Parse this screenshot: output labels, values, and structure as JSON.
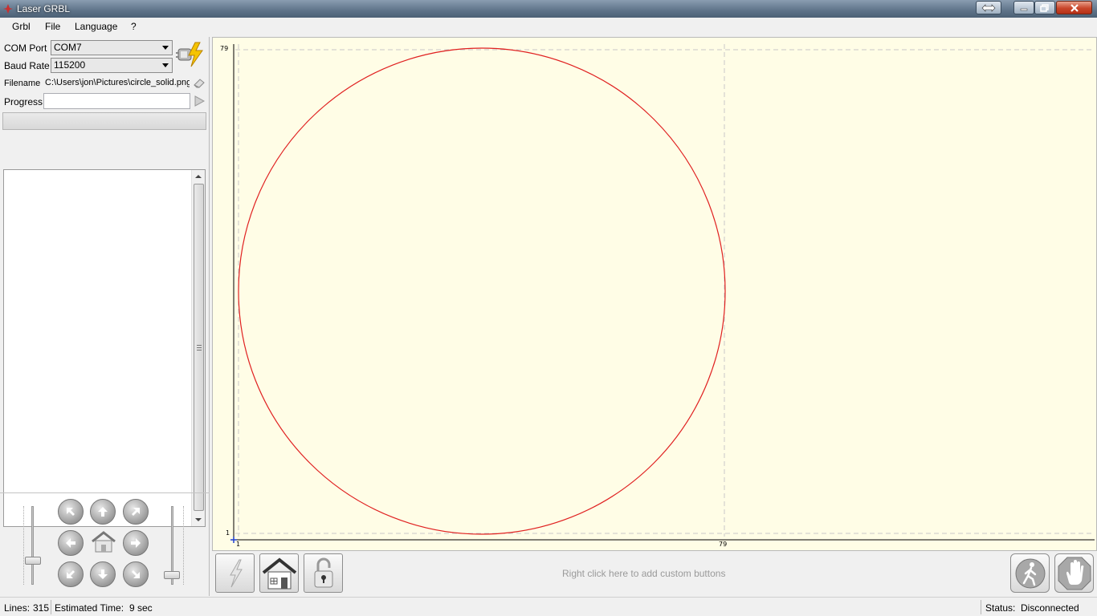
{
  "window": {
    "title": "Laser GRBL"
  },
  "menu": [
    {
      "label": "Grbl"
    },
    {
      "label": "File"
    },
    {
      "label": "Language"
    },
    {
      "label": "?"
    }
  ],
  "connection": {
    "com_port_label": "COM Port",
    "com_port_value": "COM7",
    "baud_rate_label": "Baud Rate",
    "baud_rate_value": "115200"
  },
  "file": {
    "filename_label": "Filename",
    "filename_value": "C:\\Users\\jon\\Pictures\\circle_solid.png",
    "progress_label": "Progress",
    "progress_value": ""
  },
  "canvas": {
    "x_min_label": "1",
    "x_max_label": "79",
    "y_min_label": "1",
    "y_max_label": "79",
    "circle_color": "#e02020",
    "background_color": "#fffde6"
  },
  "custom_buttons_hint": "Right click here to add custom buttons",
  "icons": [
    "connect-icon",
    "clear-file-icon",
    "run-icon",
    "reset-grbl-icon",
    "homing-icon",
    "unlock-icon",
    "walk-icon",
    "stop-hand-icon"
  ],
  "status": {
    "lines_label": "Lines:",
    "lines_value": "315",
    "time_label": "Estimated Time:",
    "time_value": "9 sec",
    "status_label": "Status:",
    "status_value": "Disconnected"
  }
}
